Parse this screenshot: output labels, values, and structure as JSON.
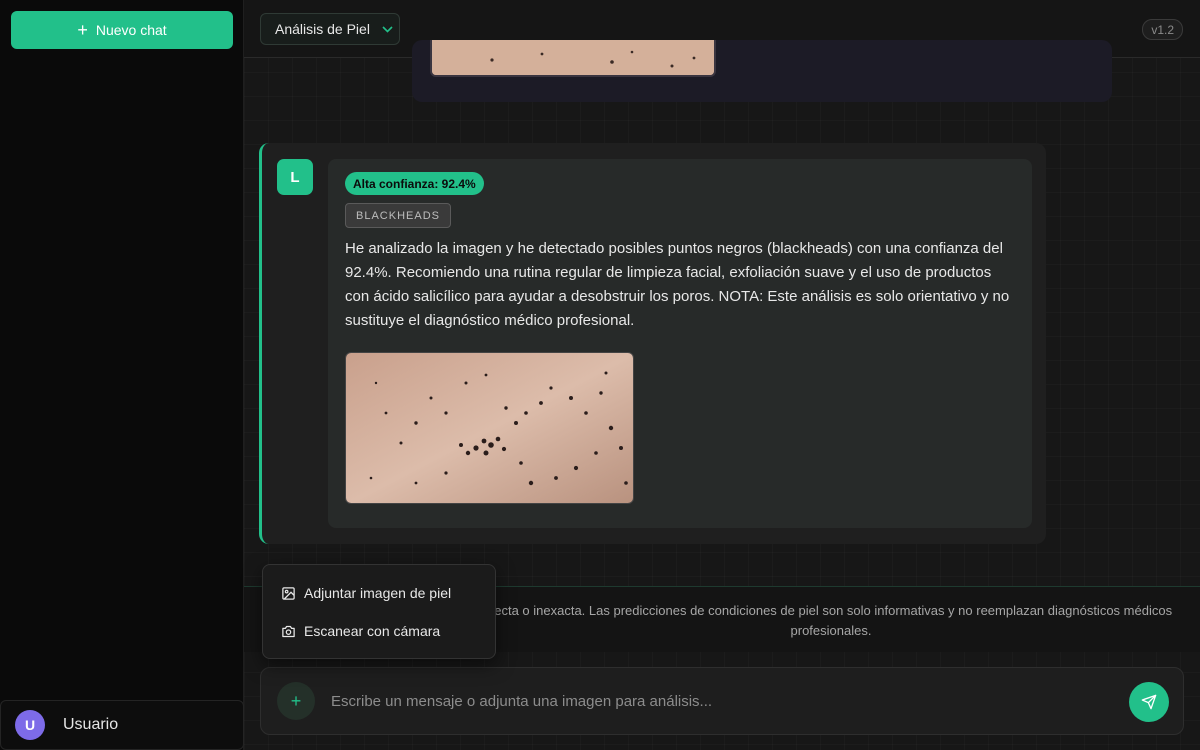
{
  "sidebar": {
    "new_chat_label": "Nuevo chat",
    "user": {
      "initial": "U",
      "name": "Usuario"
    }
  },
  "topbar": {
    "model_label": "Análisis de Piel",
    "version": "v1.2"
  },
  "message": {
    "avatar_initial": "L",
    "confidence_badge": "Alta confianza: 92.4%",
    "tag": "BLACKHEADS",
    "text": "He analizado la imagen y he detectado posibles puntos negros (blackheads) con una confianza del 92.4%. Recomiendo una rutina regular de limpieza facial, exfoliación suave y el uso de productos con ácido salicílico para ayudar a desobstruir los poros. NOTA: Este análisis es solo orientativo y no sustituye el diagnóstico médico profesional."
  },
  "disclaimer": "recta o inexacta. Las predicciones de condiciones de piel son solo informativas y no reemplazan diagnósticos médicos profesionales.",
  "attach_menu": {
    "items": [
      {
        "label": "Adjuntar imagen de piel",
        "icon": "image-icon"
      },
      {
        "label": "Escanear con cámara",
        "icon": "camera-icon"
      }
    ]
  },
  "composer": {
    "placeholder": "Escribe un mensaje o adjunta una imagen para análisis..."
  },
  "colors": {
    "accent": "#22c08a",
    "avatar_user": "#7d6be8"
  }
}
